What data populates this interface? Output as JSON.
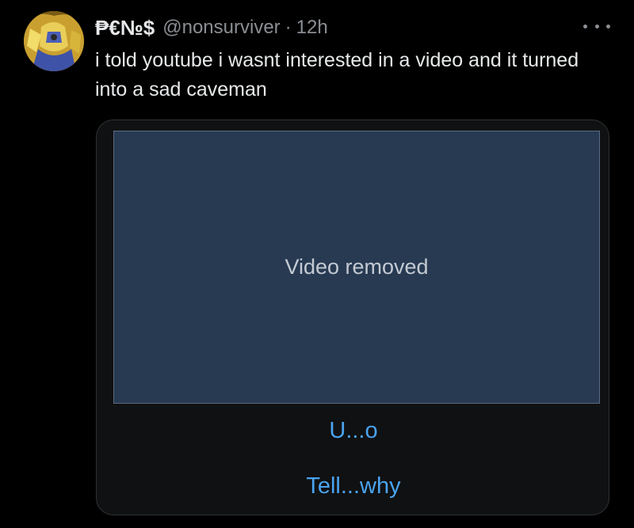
{
  "tweet": {
    "display_name": "₱€№$",
    "handle": "@nonsurviver",
    "separator": "·",
    "time": "12h",
    "text": "i told youtube i wasnt interested in a video and it turned into a sad caveman",
    "more_icon": "more-horizontal-icon"
  },
  "card": {
    "video_status": "Video removed",
    "link_1": "U...o",
    "link_2": "Tell...why"
  },
  "colors": {
    "background": "#000000",
    "text_primary": "#e7e9ea",
    "text_secondary": "#8b8f94",
    "link": "#4aa3f0",
    "video_placeholder": "#283a52"
  }
}
